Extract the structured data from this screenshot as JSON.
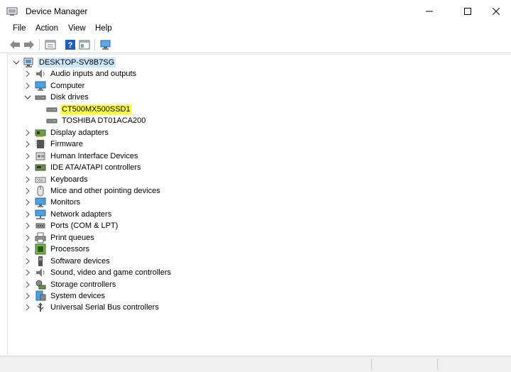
{
  "window": {
    "title": "Device Manager"
  },
  "menu": [
    "File",
    "Action",
    "View",
    "Help"
  ],
  "colors": {
    "selection": "#cce8ff",
    "highlight": "#ffff3a",
    "accent": "#2b78c2"
  },
  "tree": {
    "root": {
      "label": "DESKTOP-SV8B7SG",
      "expanded": true
    },
    "items": [
      {
        "label": "Audio inputs and outputs",
        "icon": "speaker-icon",
        "expanded": false
      },
      {
        "label": "Computer",
        "icon": "computer-icon",
        "expanded": false
      },
      {
        "label": "Disk drives",
        "icon": "disk-drive-icon",
        "expanded": true,
        "children": [
          {
            "label": "CT500MX500SSD1",
            "icon": "disk-drive-icon",
            "highlighted": true
          },
          {
            "label": "TOSHIBA DT01ACA200",
            "icon": "disk-drive-icon"
          }
        ]
      },
      {
        "label": "Display adapters",
        "icon": "display-adapter-icon",
        "expanded": false
      },
      {
        "label": "Firmware",
        "icon": "firmware-icon",
        "expanded": false
      },
      {
        "label": "Human Interface Devices",
        "icon": "hid-icon",
        "expanded": false
      },
      {
        "label": "IDE ATA/ATAPI controllers",
        "icon": "ide-controller-icon",
        "expanded": false
      },
      {
        "label": "Keyboards",
        "icon": "keyboard-icon",
        "expanded": false
      },
      {
        "label": "Mice and other pointing devices",
        "icon": "mouse-icon",
        "expanded": false
      },
      {
        "label": "Monitors",
        "icon": "monitor-icon",
        "expanded": false
      },
      {
        "label": "Network adapters",
        "icon": "network-adapter-icon",
        "expanded": false
      },
      {
        "label": "Ports (COM & LPT)",
        "icon": "port-icon",
        "expanded": false
      },
      {
        "label": "Print queues",
        "icon": "printer-icon",
        "expanded": false
      },
      {
        "label": "Processors",
        "icon": "processor-icon",
        "expanded": false
      },
      {
        "label": "Software devices",
        "icon": "software-device-icon",
        "expanded": false
      },
      {
        "label": "Sound, video and game controllers",
        "icon": "sound-icon",
        "expanded": false
      },
      {
        "label": "Storage controllers",
        "icon": "storage-controller-icon",
        "expanded": false
      },
      {
        "label": "System devices",
        "icon": "system-devices-icon",
        "expanded": false
      },
      {
        "label": "Universal Serial Bus controllers",
        "icon": "usb-icon",
        "expanded": false
      }
    ]
  }
}
